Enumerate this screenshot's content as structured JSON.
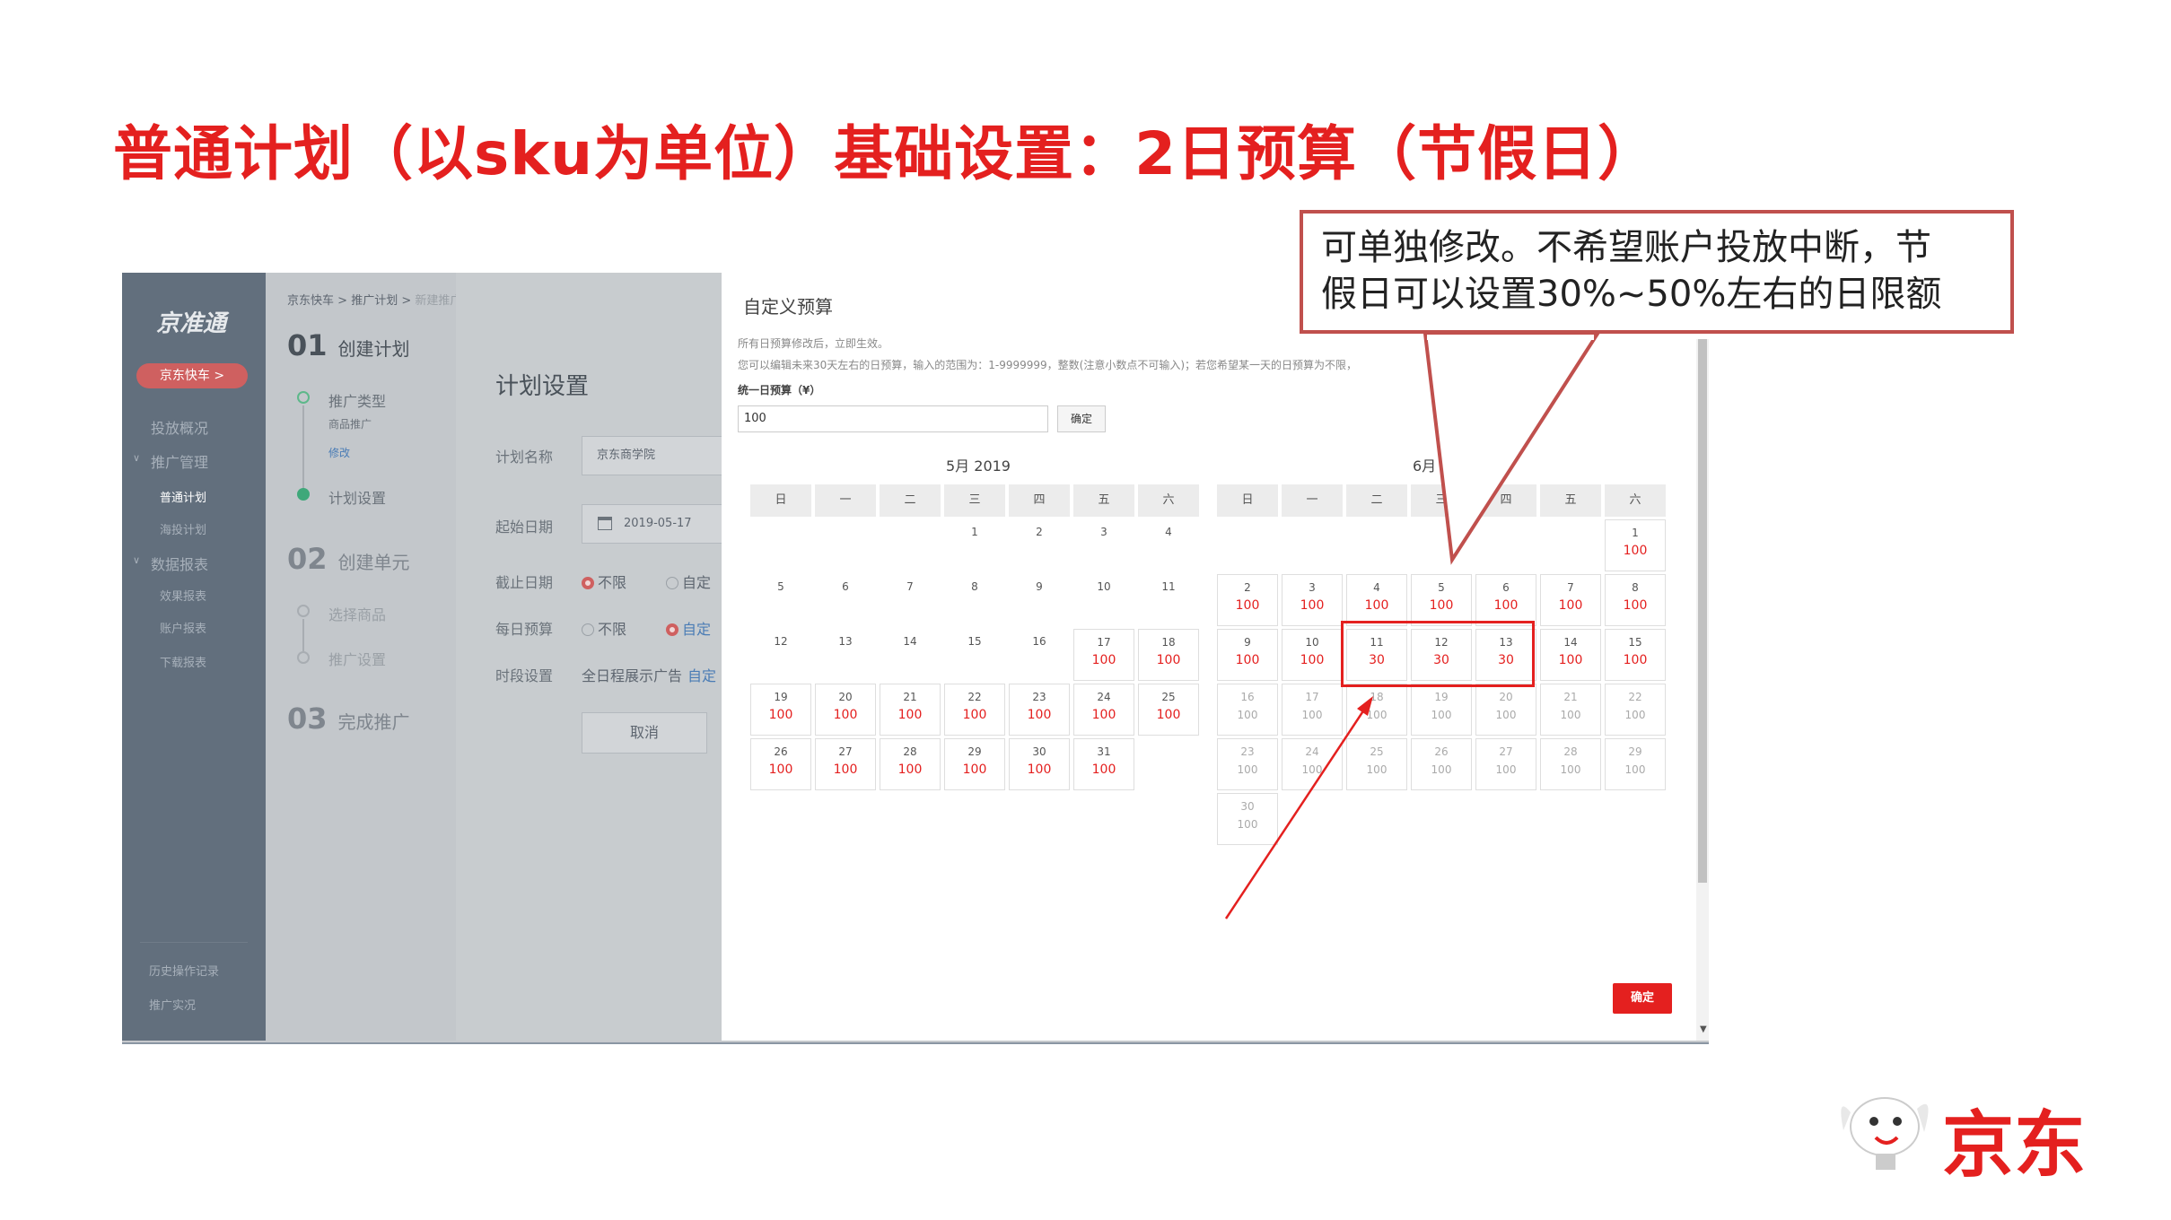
{
  "slide": {
    "title": "普通计划（以sku为单位）基础设置：2日预算（节假日）"
  },
  "callout": {
    "line1": "可单独修改。不希望账户投放中断，节",
    "line2": "假日可以设置30%~50%左右的日限额"
  },
  "sidebar": {
    "logo": "京准通",
    "brand_button": "京东快车 >",
    "items": [
      "投放概况",
      "推广管理",
      "普通计划",
      "海投计划",
      "数据报表",
      "效果报表",
      "账户报表",
      "下载报表"
    ],
    "bottom": [
      "历史操作记录",
      "推广实况"
    ]
  },
  "breadcrumb": {
    "a": "京东快车",
    "sep": ">",
    "b": "推广计划",
    "c": "新建推广流程"
  },
  "steps": {
    "s1_num": "01",
    "s1_label": "创建计划",
    "s1_sub1": "推广类型",
    "s1_sub1a": "商品推广",
    "s1_sub1b": "修改",
    "s1_sub2": "计划设置",
    "s2_num": "02",
    "s2_label": "创建单元",
    "s2_sub1": "选择商品",
    "s2_sub2": "推广设置",
    "s3_num": "03",
    "s3_label": "完成推广"
  },
  "form": {
    "title": "计划设置",
    "name_label": "计划名称",
    "name_value": "京东商学院",
    "start_label": "起始日期",
    "start_value": "2019-05-17",
    "end_label": "截止日期",
    "end_opt1": "不限",
    "end_opt2": "自定",
    "budget_label": "每日预算",
    "budget_opt1": "不限",
    "budget_opt2": "自定",
    "time_label": "时段设置",
    "time_value": "全日程展示广告",
    "time_link": "自定",
    "cancel": "取消"
  },
  "modal": {
    "title": "自定义预算",
    "note1": "所有日预算修改后，立即生效。",
    "note2": "您可以编辑未来30天左右的日预算，输入的范围为：1-9999999，整数(注意小数点不可输入)；若您希望某一天的日预算为不限，",
    "uniform_label": "统一日预算（¥）",
    "uniform_value": "100",
    "uniform_button": "确定",
    "ok_button": "确定",
    "weekdays": [
      "日",
      "一",
      "二",
      "三",
      "四",
      "五",
      "六"
    ],
    "may": {
      "title": "5月 2019",
      "days": [
        {
          "d": ""
        },
        {
          "d": ""
        },
        {
          "d": ""
        },
        {
          "d": "1"
        },
        {
          "d": "2"
        },
        {
          "d": "3"
        },
        {
          "d": "4"
        },
        {
          "d": "5"
        },
        {
          "d": "6"
        },
        {
          "d": "7"
        },
        {
          "d": "8"
        },
        {
          "d": "9"
        },
        {
          "d": "10"
        },
        {
          "d": "11"
        },
        {
          "d": "12"
        },
        {
          "d": "13"
        },
        {
          "d": "14"
        },
        {
          "d": "15"
        },
        {
          "d": "16"
        },
        {
          "d": "17",
          "v": "100"
        },
        {
          "d": "18",
          "v": "100"
        },
        {
          "d": "19",
          "v": "100"
        },
        {
          "d": "20",
          "v": "100"
        },
        {
          "d": "21",
          "v": "100"
        },
        {
          "d": "22",
          "v": "100"
        },
        {
          "d": "23",
          "v": "100"
        },
        {
          "d": "24",
          "v": "100"
        },
        {
          "d": "25",
          "v": "100"
        },
        {
          "d": "26",
          "v": "100"
        },
        {
          "d": "27",
          "v": "100"
        },
        {
          "d": "28",
          "v": "100"
        },
        {
          "d": "29",
          "v": "100"
        },
        {
          "d": "30",
          "v": "100"
        },
        {
          "d": "31",
          "v": "100"
        }
      ]
    },
    "june": {
      "title": "6月",
      "days": [
        {
          "d": ""
        },
        {
          "d": ""
        },
        {
          "d": ""
        },
        {
          "d": ""
        },
        {
          "d": ""
        },
        {
          "d": ""
        },
        {
          "d": "1",
          "v": "100"
        },
        {
          "d": "2",
          "v": "100"
        },
        {
          "d": "3",
          "v": "100"
        },
        {
          "d": "4",
          "v": "100"
        },
        {
          "d": "5",
          "v": "100"
        },
        {
          "d": "6",
          "v": "100"
        },
        {
          "d": "7",
          "v": "100"
        },
        {
          "d": "8",
          "v": "100"
        },
        {
          "d": "9",
          "v": "100"
        },
        {
          "d": "10",
          "v": "100"
        },
        {
          "d": "11",
          "v": "30"
        },
        {
          "d": "12",
          "v": "30"
        },
        {
          "d": "13",
          "v": "30"
        },
        {
          "d": "14",
          "v": "100"
        },
        {
          "d": "15",
          "v": "100"
        },
        {
          "d": "16",
          "v": "100",
          "past": true
        },
        {
          "d": "17",
          "v": "100",
          "past": true
        },
        {
          "d": "18",
          "v": "100",
          "past": true
        },
        {
          "d": "19",
          "v": "100",
          "past": true
        },
        {
          "d": "20",
          "v": "100",
          "past": true
        },
        {
          "d": "21",
          "v": "100",
          "past": true
        },
        {
          "d": "22",
          "v": "100",
          "past": true
        },
        {
          "d": "23",
          "v": "100",
          "past": true
        },
        {
          "d": "24",
          "v": "100",
          "past": true
        },
        {
          "d": "25",
          "v": "100",
          "past": true
        },
        {
          "d": "26",
          "v": "100",
          "past": true
        },
        {
          "d": "27",
          "v": "100",
          "past": true
        },
        {
          "d": "28",
          "v": "100",
          "past": true
        },
        {
          "d": "29",
          "v": "100",
          "past": true
        },
        {
          "d": "30",
          "v": "100",
          "past": true
        }
      ]
    }
  },
  "footer": {
    "logo_text": "京东"
  },
  "colors": {
    "accent": "#e4201f",
    "sidebar": "#626f7d",
    "callout_border": "#c0504d"
  }
}
